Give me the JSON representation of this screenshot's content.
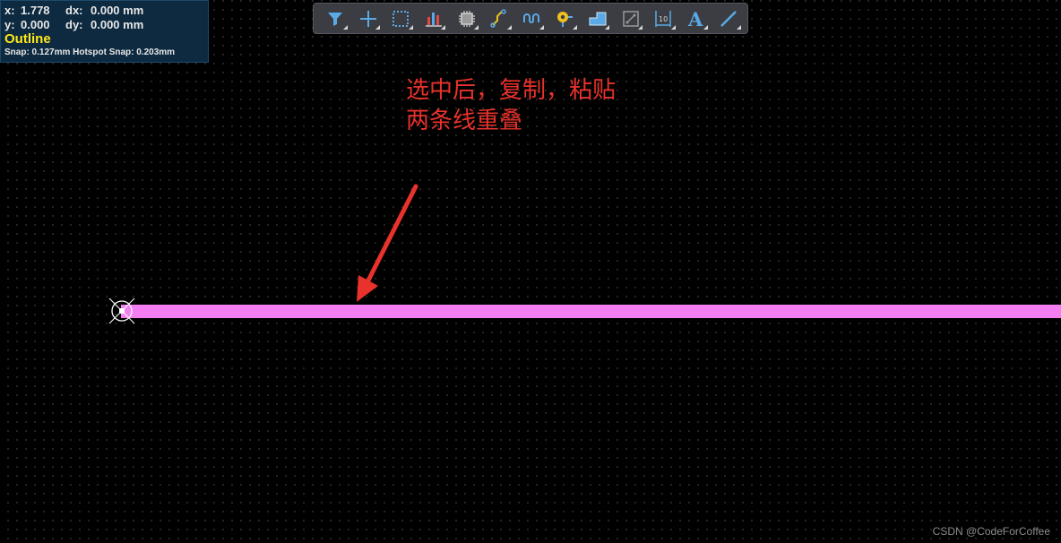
{
  "hud": {
    "x_label": "x:",
    "x_value": "1.778",
    "dx_label": "dx:",
    "dx_value": "0.000 mm",
    "y_label": "y:",
    "y_value": "0.000",
    "dy_label": "dy:",
    "dy_value": "0.000 mm",
    "layer": "Outline",
    "snap": "Snap: 0.127mm Hotspot Snap: 0.203mm"
  },
  "toolbar": {
    "tools": [
      {
        "icon": "filter-icon",
        "color": "#5aa9e6"
      },
      {
        "icon": "crosshair-icon",
        "color": "#5aa9e6"
      },
      {
        "icon": "select-rectangle-icon",
        "color": "#5aa9e6"
      },
      {
        "icon": "chart-icon",
        "color": "#e04848"
      },
      {
        "icon": "component-icon",
        "color": "#cfcfcf"
      },
      {
        "icon": "route-icon",
        "color": "#e8c020"
      },
      {
        "icon": "length-tuning-icon",
        "color": "#5aa9e6"
      },
      {
        "icon": "via-icon",
        "color": "#f0c020"
      },
      {
        "icon": "polygon-pour-icon",
        "color": "#5aa9e6"
      },
      {
        "icon": "keepout-icon",
        "color": "#9a9a9a"
      },
      {
        "icon": "dimension-icon",
        "color": "#5aa9e6"
      },
      {
        "icon": "text-icon",
        "color": "#5aa9e6"
      },
      {
        "icon": "line-icon",
        "color": "#5aa9e6"
      }
    ]
  },
  "annotation": {
    "line1": "选中后，复制，粘贴",
    "line2": "两条线重叠",
    "color": "#e8322b"
  },
  "trace": {
    "color": "#f27ef2"
  },
  "watermark": "CSDN @CodeForCoffee"
}
